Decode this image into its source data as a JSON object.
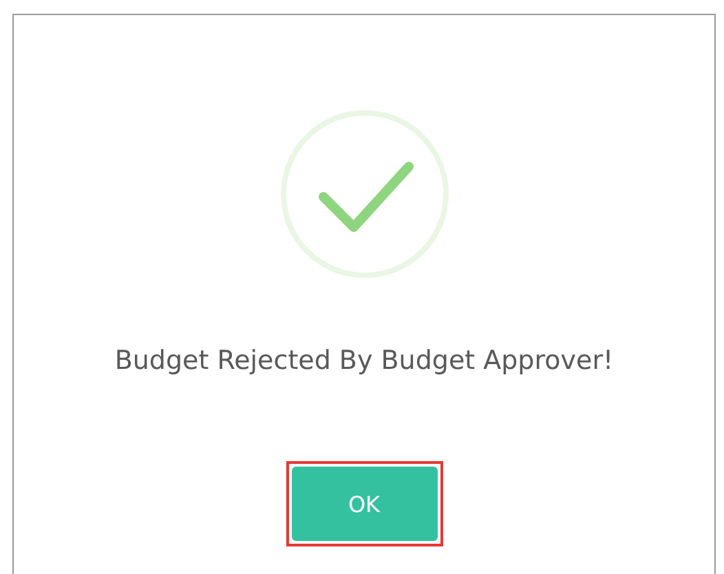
{
  "dialog": {
    "message": "Budget Rejected By Budget Approver!",
    "buttons": [
      {
        "label": "OK",
        "highlighted": true
      }
    ]
  }
}
